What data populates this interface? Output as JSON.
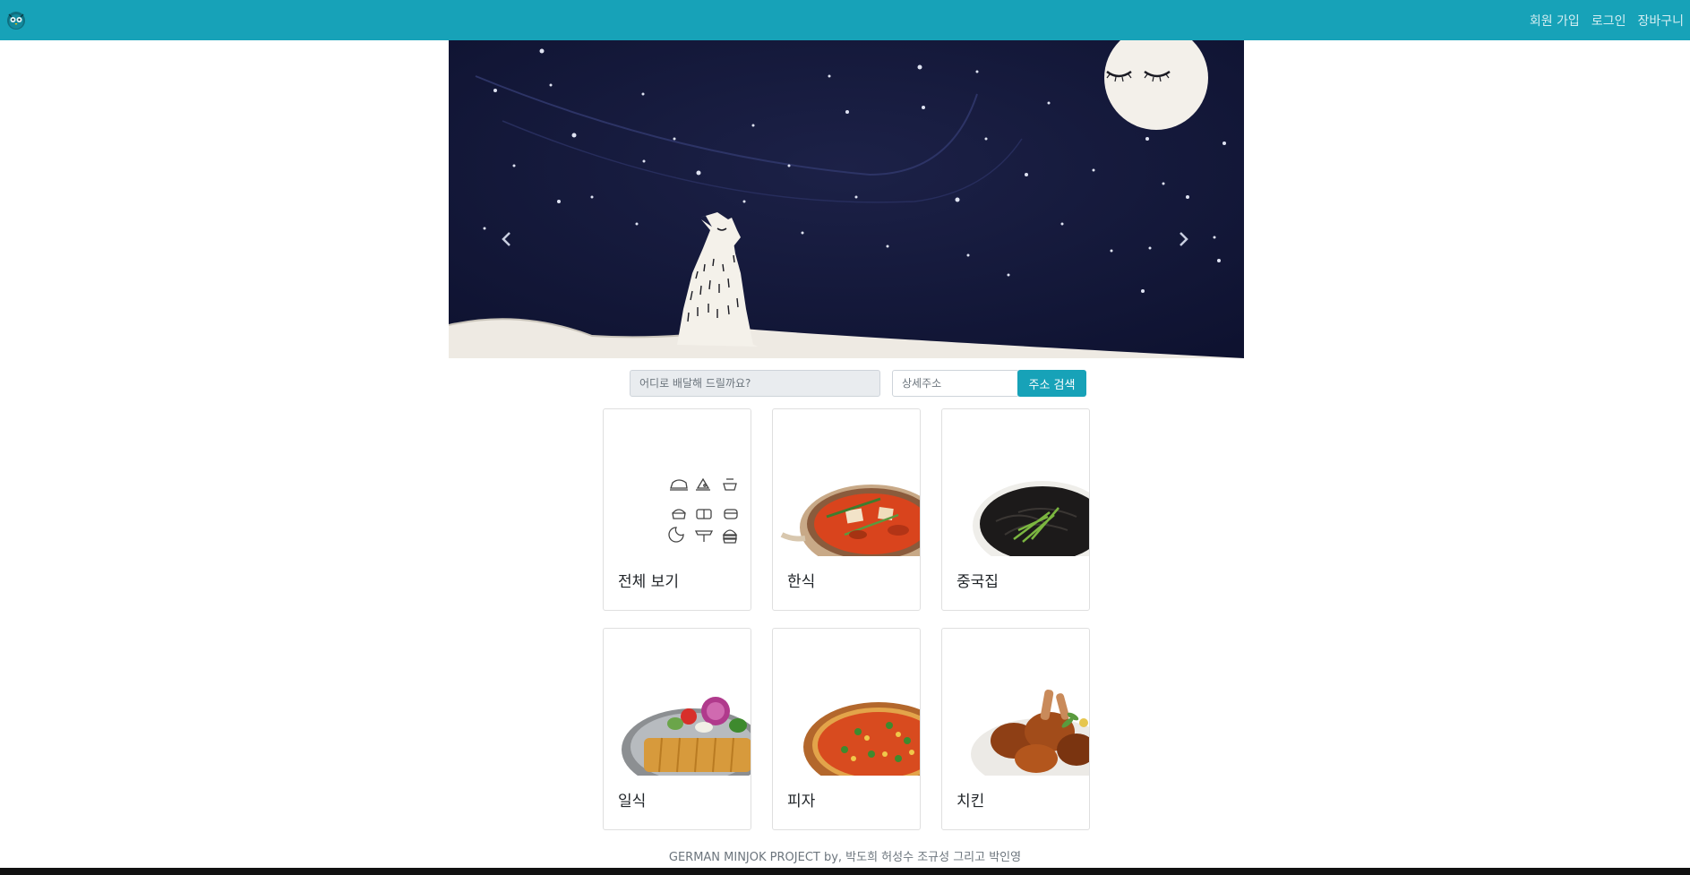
{
  "navbar": {
    "logo_icon": "owl-logo-icon",
    "links": [
      {
        "label": "회원 가입"
      },
      {
        "label": "로그인"
      },
      {
        "label": "장바구니"
      }
    ],
    "colors": {
      "background": "#17a2b8"
    }
  },
  "carousel": {
    "slide_icon": "night-sky-wolf-moon-illustration",
    "prev_icon": "chevron-left-icon",
    "next_icon": "chevron-right-icon"
  },
  "search": {
    "address_placeholder": "어디로 배달해 드릴까요?",
    "detail_placeholder": "상세주소",
    "button_label": "주소 검색"
  },
  "categories": [
    {
      "label": "전체 보기",
      "icon": "all-food-icons-grid"
    },
    {
      "label": "한식",
      "icon": "korean-stew-photo"
    },
    {
      "label": "중국집",
      "icon": "jajangmyeon-photo"
    },
    {
      "label": "일식",
      "icon": "tonkatsu-photo"
    },
    {
      "label": "피자",
      "icon": "pizza-photo"
    },
    {
      "label": "치킨",
      "icon": "fried-chicken-photo"
    }
  ],
  "footer": {
    "text": "GERMAN MINJOK PROJECT by, 박도희 허성수 조규성 그리고 박인영"
  }
}
